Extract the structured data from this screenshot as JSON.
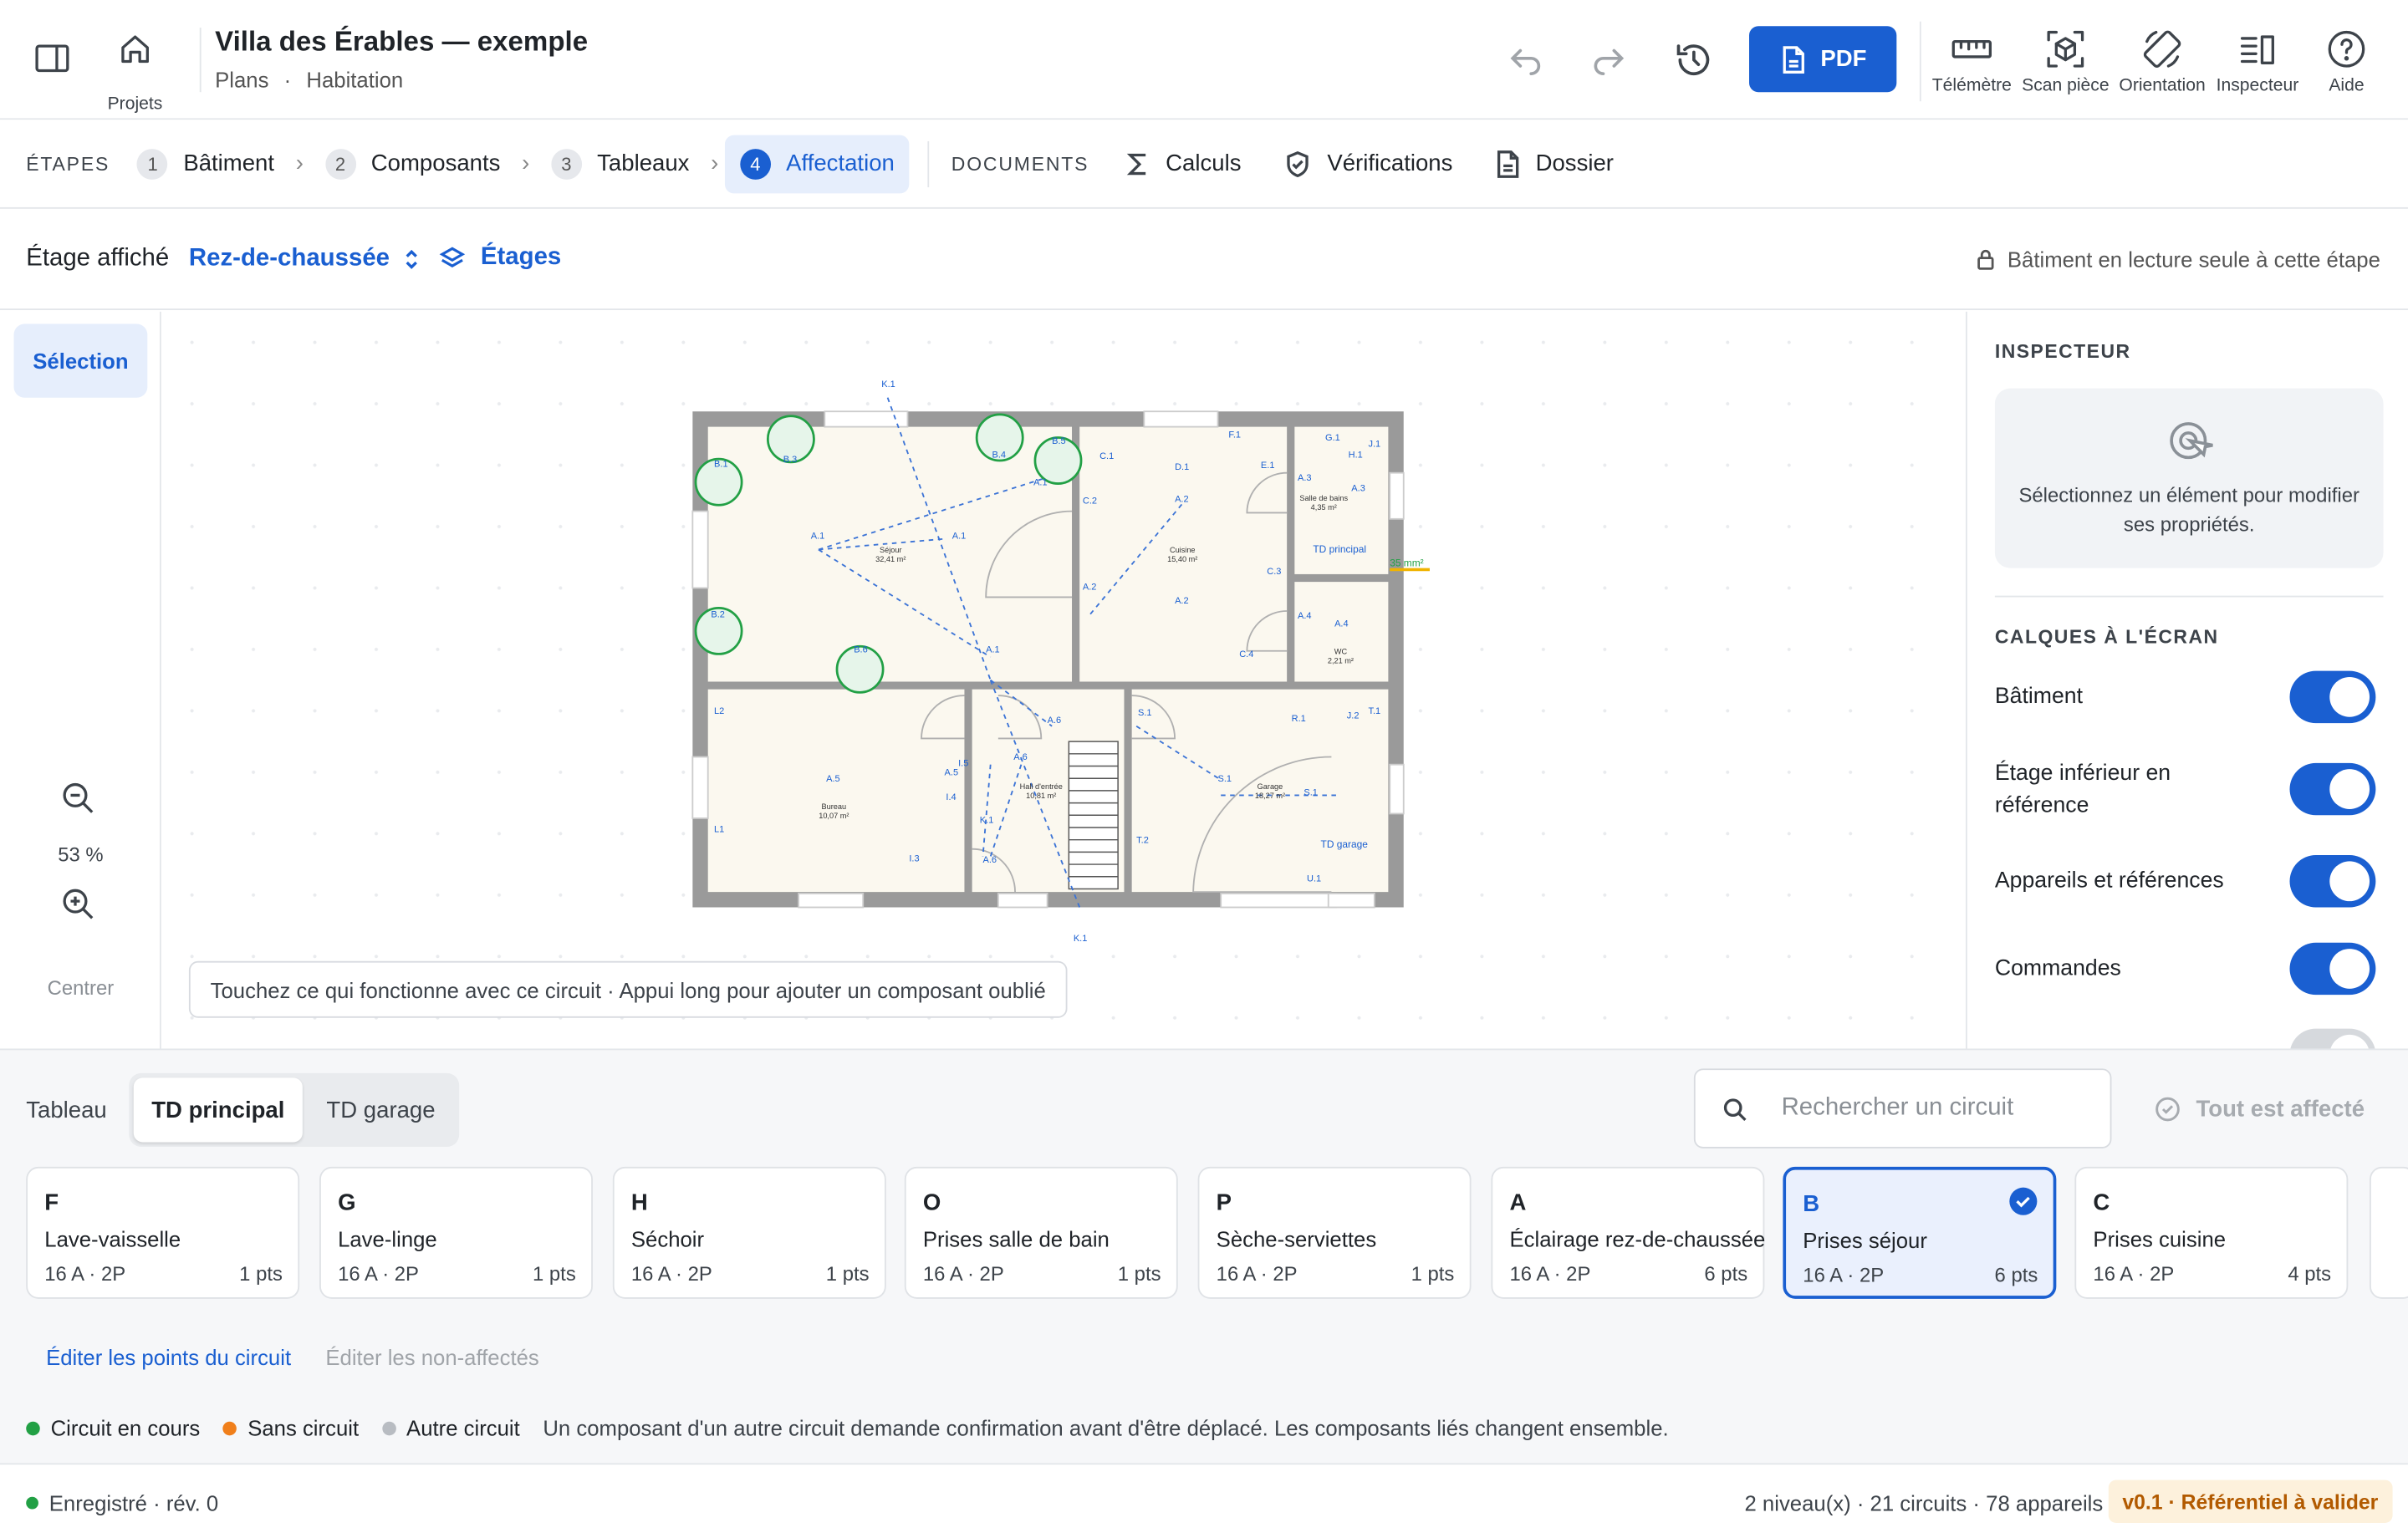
{
  "header": {
    "title": "Villa des Érables — exemple",
    "crumb1": "Plans",
    "crumb_sep": "·",
    "crumb2": "Habitation",
    "projects_label": "Projets",
    "pdf_label": "PDF",
    "tools": [
      "Télémètre",
      "Scan pièce",
      "Orientation",
      "Inspecteur",
      "Aide"
    ]
  },
  "steps": {
    "label": "ÉTAPES",
    "items": [
      {
        "num": "1",
        "label": "Bâtiment"
      },
      {
        "num": "2",
        "label": "Composants"
      },
      {
        "num": "3",
        "label": "Tableaux"
      },
      {
        "num": "4",
        "label": "Affectation"
      }
    ],
    "documents_label": "DOCUMENTS",
    "docs": [
      "Calculs",
      "Vérifications",
      "Dossier"
    ]
  },
  "floor": {
    "label": "Étage affiché",
    "value": "Rez-de-chaussée",
    "floors_link": "Étages",
    "readonly": "Bâtiment en lecture seule à cette étape"
  },
  "tools": {
    "selection": "Sélection",
    "zoom": "53 %",
    "center": "Centrer"
  },
  "canvas": {
    "hint": "Touchez ce qui fonctionne avec ce circuit · Appui long pour ajouter un composant oublié",
    "rooms": [
      {
        "name": "Séjour",
        "area": "32,41 m²"
      },
      {
        "name": "Cuisine",
        "area": "15,40 m²"
      },
      {
        "name": "Salle de bains",
        "area": "4,35 m²"
      },
      {
        "name": "WC",
        "area": "2,21 m²"
      },
      {
        "name": "Bureau",
        "area": "10,07 m²"
      },
      {
        "name": "Hall d'entrée",
        "area": "10,81 m²"
      },
      {
        "name": "Garage",
        "area": "18,27 m²"
      }
    ],
    "panels": [
      "TD principal",
      "TD garage"
    ],
    "cable": "35 mm²",
    "tags": [
      "K.1",
      "B.1",
      "B.3",
      "B.4",
      "B.5",
      "B.2",
      "B.6",
      "A.1",
      "A.1",
      "A.1",
      "A.1",
      "C.1",
      "C.2",
      "D.1",
      "E.1",
      "F.1",
      "A.2",
      "A.2",
      "A.2",
      "C.3",
      "C.4",
      "G.1",
      "H.1",
      "J.1",
      "A.3",
      "A.3",
      "A.4",
      "A.4",
      "L2",
      "L1",
      "A.5",
      "A.5",
      "I.5",
      "I.4",
      "I.3",
      "A.6",
      "A.6",
      "A.6",
      "K.1",
      "K.1",
      "S.1",
      "S.1",
      "S.1",
      "R.1",
      "J.2",
      "T.1",
      "T.2",
      "U.1"
    ]
  },
  "inspector": {
    "title": "INSPECTEUR",
    "empty": "Sélectionnez un élément pour modifier ses propriétés.",
    "layers_title": "CALQUES À L'ÉCRAN",
    "layers": [
      {
        "label": "Bâtiment",
        "on": true
      },
      {
        "label": "Étage inférieur en référence",
        "on": true
      },
      {
        "label": "Appareils et références",
        "on": true
      },
      {
        "label": "Commandes",
        "on": true
      }
    ]
  },
  "board": {
    "label": "Tableau",
    "tabs": [
      "TD principal",
      "TD garage"
    ],
    "search_placeholder": "Rechercher un circuit",
    "all_assigned": "Tout est affecté",
    "circuits": [
      {
        "letter": "F",
        "name": "Lave-vaisselle",
        "spec": "16 A · 2P",
        "pts": "1 pts"
      },
      {
        "letter": "G",
        "name": "Lave-linge",
        "spec": "16 A · 2P",
        "pts": "1 pts"
      },
      {
        "letter": "H",
        "name": "Séchoir",
        "spec": "16 A · 2P",
        "pts": "1 pts"
      },
      {
        "letter": "O",
        "name": "Prises salle de bain",
        "spec": "16 A · 2P",
        "pts": "1 pts"
      },
      {
        "letter": "P",
        "name": "Sèche-serviettes",
        "spec": "16 A · 2P",
        "pts": "1 pts"
      },
      {
        "letter": "A",
        "name": "Éclairage rez-de-chaussée",
        "spec": "16 A · 2P",
        "pts": "6 pts"
      },
      {
        "letter": "B",
        "name": "Prises séjour",
        "spec": "16 A · 2P",
        "pts": "6 pts",
        "selected": true
      },
      {
        "letter": "C",
        "name": "Prises cuisine",
        "spec": "16 A · 2P",
        "pts": "4 pts"
      }
    ],
    "edit_points": "Éditer les points du circuit",
    "edit_unassigned": "Éditer les non-affectés",
    "legend": [
      {
        "label": "Circuit en cours",
        "color": "#22a045"
      },
      {
        "label": "Sans circuit",
        "color": "#f07f1b"
      },
      {
        "label": "Autre circuit",
        "color": "#b8bcc2"
      }
    ],
    "legend_note": "Un composant d'un autre circuit demande confirmation avant d'être déplacé. Les composants liés changent ensemble."
  },
  "status": {
    "saved": "Enregistré · rév. 0",
    "summary": "2 niveau(x) · 21 circuits · 78 appareils",
    "version": "v0.1 · Référentiel à valider"
  }
}
